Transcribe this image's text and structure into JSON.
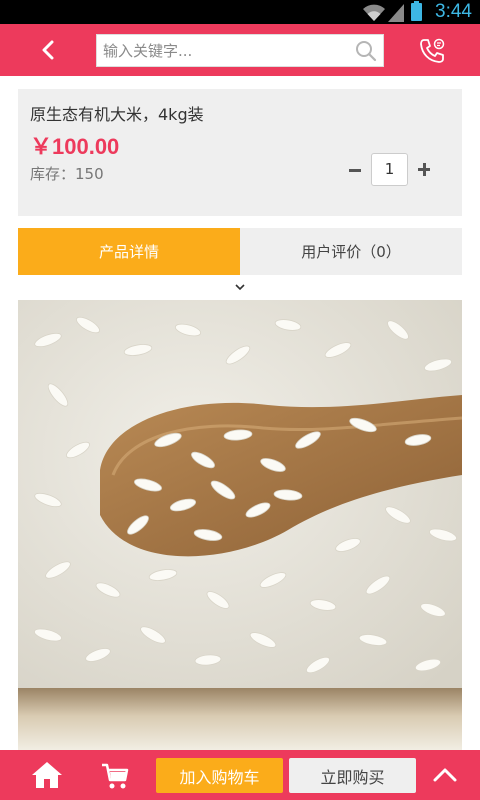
{
  "status_bar": {
    "time": "3:44"
  },
  "header": {
    "search_placeholder": "输入关键字..."
  },
  "product": {
    "title": "原生态有机大米，4kg装",
    "price": "￥100.00",
    "stock_label": "库存：150",
    "quantity": "1"
  },
  "tabs": [
    {
      "label": "产品详情",
      "active": true
    },
    {
      "label": "用户评价（0）",
      "active": false
    }
  ],
  "bottom_bar": {
    "add_to_cart_label": "加入购物车",
    "buy_now_label": "立即购买"
  },
  "colors": {
    "brand": "#ed3a5c",
    "accent": "#fbac1a",
    "card": "#efefef"
  },
  "icons": [
    "wifi-icon",
    "signal-icon",
    "battery-icon",
    "back-arrow-icon",
    "search-icon",
    "phone-icon",
    "chevron-down-icon",
    "home-icon",
    "cart-icon",
    "chevron-up-icon"
  ]
}
